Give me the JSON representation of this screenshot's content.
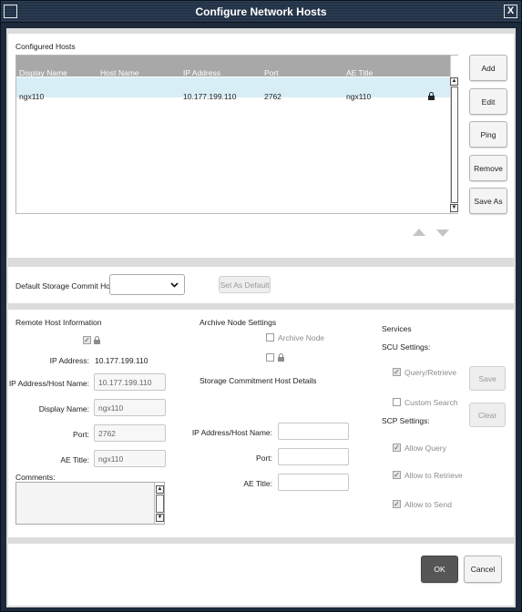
{
  "window": {
    "title": "Configure Network Hosts",
    "close_glyph": "X"
  },
  "hosts": {
    "section_title": "Configured Hosts",
    "columns": [
      "Display Name",
      "Host Name",
      "IP Address",
      "Port",
      "AE Title"
    ],
    "rows": [
      {
        "display_name": "ngx110",
        "host_name": "",
        "ip": "10.177.199.110",
        "port": "2762",
        "ae_title": "ngx110",
        "locked": true
      }
    ],
    "buttons": {
      "add": "Add",
      "edit": "Edit",
      "ping": "Ping",
      "remove": "Remove",
      "save_as": "Save As"
    }
  },
  "default_commit": {
    "label": "Default Storage Commit Host",
    "selected": "",
    "set_default": "Set As Default"
  },
  "remote": {
    "title": "Remote Host Information",
    "ip_label": "IP Address:",
    "ip_value": "10.177.199.110",
    "ip_host_label": "IP Address/Host Name:",
    "ip_host_value": "10.177.199.110",
    "display_name_label": "Display Name:",
    "display_name_value": "ngx110",
    "port_label": "Port:",
    "port_value": "2762",
    "ae_title_label": "AE Title:",
    "ae_title_value": "ngx110",
    "comments_label": "Comments:",
    "comments_value": ""
  },
  "archive": {
    "title": "Archive Node Settings",
    "archive_node_label": "Archive Node",
    "commit_title": "Storage Commitment Host Details",
    "ip_host_label": "IP Address/Host Name:",
    "port_label": "Port:",
    "ae_title_label": "AE Title:"
  },
  "services": {
    "title": "Services",
    "scu_title": "SCU Settings:",
    "query_retrieve": "Query/Retrieve",
    "custom_search": "Custom Search",
    "scp_title": "SCP Settings:",
    "allow_query": "Allow Query",
    "allow_retrieve": "Allow to Retrieve",
    "allow_send": "Allow to Send",
    "save": "Save",
    "clear": "Clear"
  },
  "footer": {
    "ok": "OK",
    "cancel": "Cancel"
  }
}
